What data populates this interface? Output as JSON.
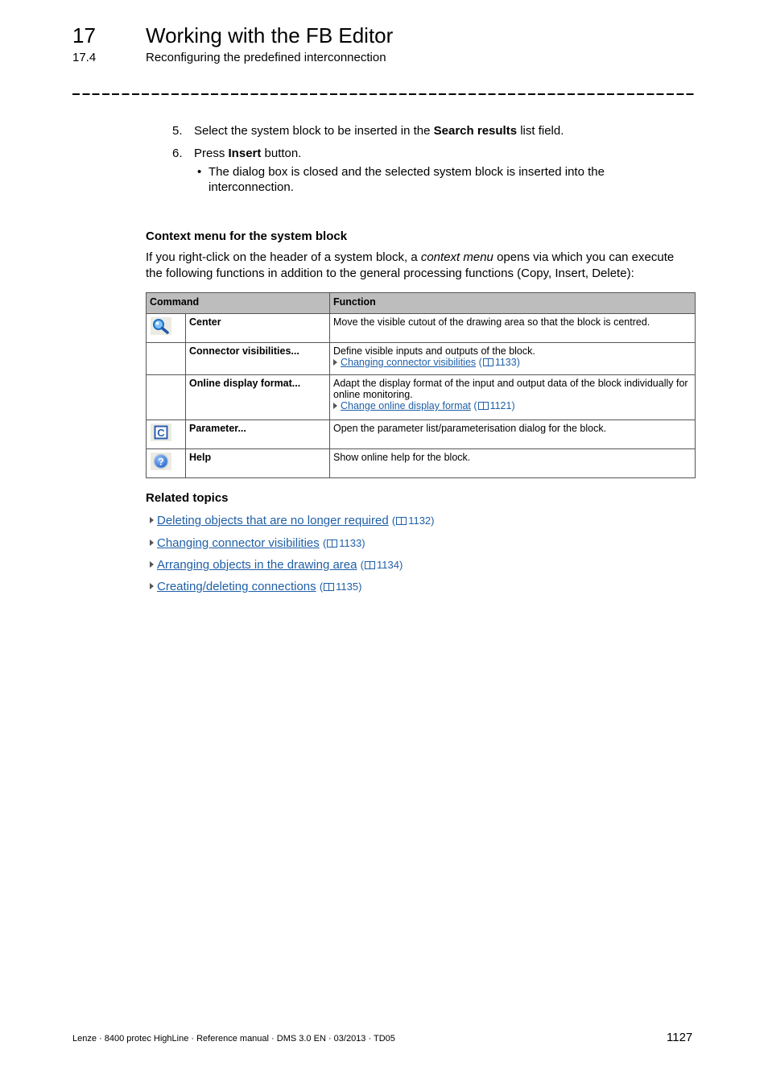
{
  "header": {
    "chapter_number": "17",
    "chapter_title": "Working with the FB Editor",
    "section_number": "17.4",
    "section_title": "Reconfiguring the predefined interconnection"
  },
  "steps": [
    {
      "number": "5.",
      "before": "Select the system block to be inserted in the ",
      "bold": "Search results",
      "after": " list field."
    },
    {
      "number": "6.",
      "before": "Press ",
      "bold": "Insert",
      "after": " button."
    }
  ],
  "step6_bullet": {
    "line1": "The dialog box is closed and the selected system block is inserted into the",
    "line2": "interconnection."
  },
  "context_menu": {
    "heading": "Context menu for the system block",
    "intro_before": "If you right-click on the header of a system block, a ",
    "intro_italic": "context menu",
    "intro_after_line1": " opens via which you can execute",
    "intro_line2": "the following functions in addition to the general processing functions (Copy, Insert, Delete):"
  },
  "table": {
    "headers": {
      "command": "Command",
      "function": "Function"
    },
    "rows": [
      {
        "icon": "magnifier-icon",
        "command": "Center",
        "function": "Move the visible cutout of the drawing area so that the block is centred.",
        "link": null,
        "page": null
      },
      {
        "icon": null,
        "command": "Connector visibilities...",
        "function": "Define visible inputs and outputs of the block.",
        "link": "Changing connector visibilities",
        "page": "1133"
      },
      {
        "icon": null,
        "command": "Online display format...",
        "function": "Adapt the display format of the input and output data of the block individually for online monitoring.",
        "link": "Change online display format",
        "page": "1121"
      },
      {
        "icon": "parameter-c-icon",
        "command": "Parameter...",
        "function": "Open the parameter list/parameterisation dialog for the block.",
        "link": null,
        "page": null
      },
      {
        "icon": "help-icon",
        "command": "Help",
        "function": "Show online help for the block.",
        "link": null,
        "page": null
      }
    ]
  },
  "related": {
    "heading": "Related topics",
    "items": [
      {
        "label": "Deleting objects that are no longer required",
        "page": "1132"
      },
      {
        "label": "Changing connector visibilities",
        "page": "1133"
      },
      {
        "label": "Arranging objects in the drawing area",
        "page": "1134"
      },
      {
        "label": "Creating/deleting connections",
        "page": "1135"
      }
    ]
  },
  "footer": {
    "text": "Lenze · 8400 protec HighLine · Reference manual · DMS 3.0 EN · 03/2013 · TD05",
    "page_number": "1127"
  },
  "colors": {
    "link": "#1f5fa6",
    "table_header_bg": "#bdbdbd"
  }
}
